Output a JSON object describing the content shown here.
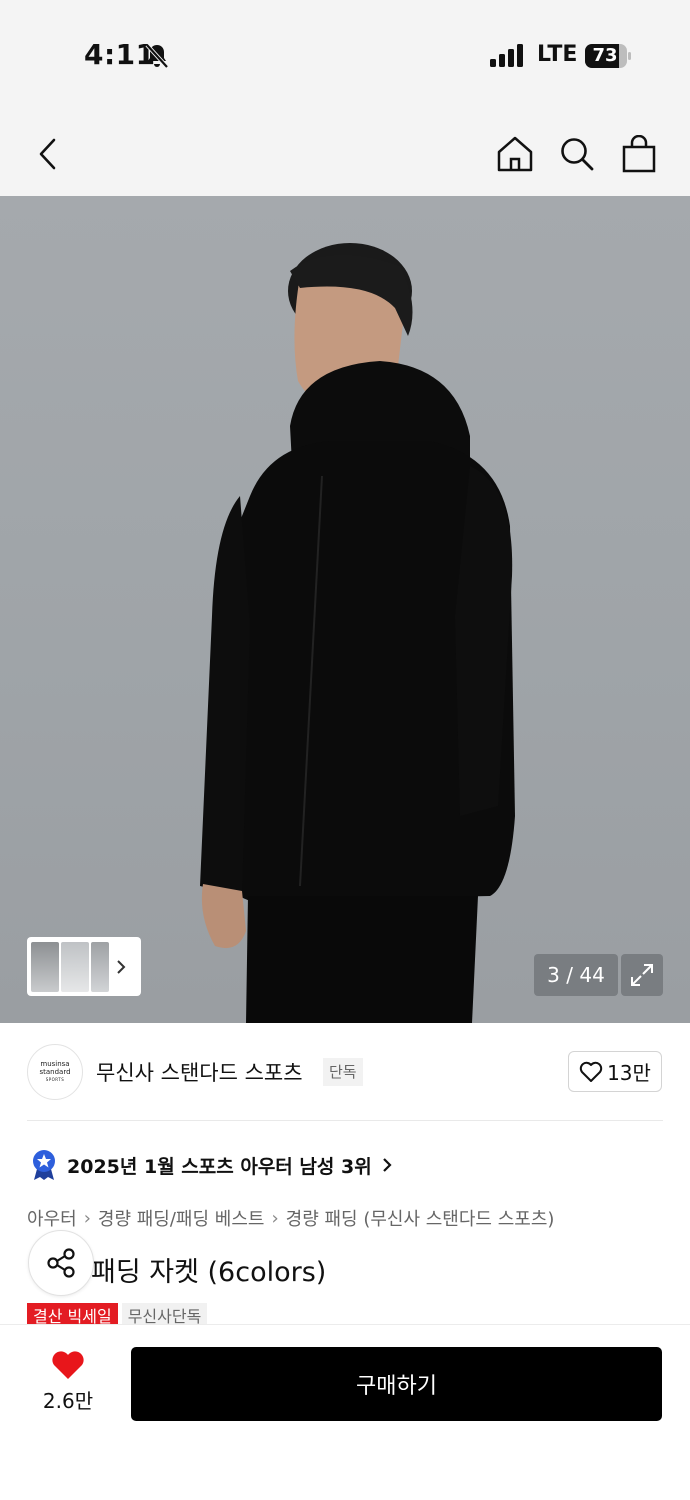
{
  "status_bar": {
    "time": "4:11",
    "network": "LTE",
    "battery": "73"
  },
  "nav": {
    "back": "back",
    "home": "home",
    "search": "search",
    "cart": "shopping-bag"
  },
  "gallery": {
    "counter": "3 / 44",
    "image": "model wearing black hooded padding jacket"
  },
  "brand": {
    "logo_line1": "musinsa",
    "logo_line2": "standard",
    "logo_line3": "SPORTS",
    "name": "무신사 스탠다드 스포츠",
    "tag": "단독",
    "likes": "13만"
  },
  "ranking": {
    "text": "2025년 1월 스포츠 아우터 남성 3위"
  },
  "breadcrumb": {
    "items": [
      "아우터",
      "경량 패딩/패딩 베스트",
      "경량 패딩 (무신사 스탠다드 스포츠)"
    ]
  },
  "product": {
    "title": "패딩 자켓 (6colors)"
  },
  "badges": {
    "sale": "결산 빅세일",
    "exclusive": "무신사단독"
  },
  "bottom": {
    "wish_count": "2.6만",
    "buy_label": "구매하기"
  },
  "colors": {
    "accent_red": "#e31c23",
    "heart_red": "#e8161b",
    "buy_black": "#000000",
    "rank_blue": "#2e5fdc"
  }
}
